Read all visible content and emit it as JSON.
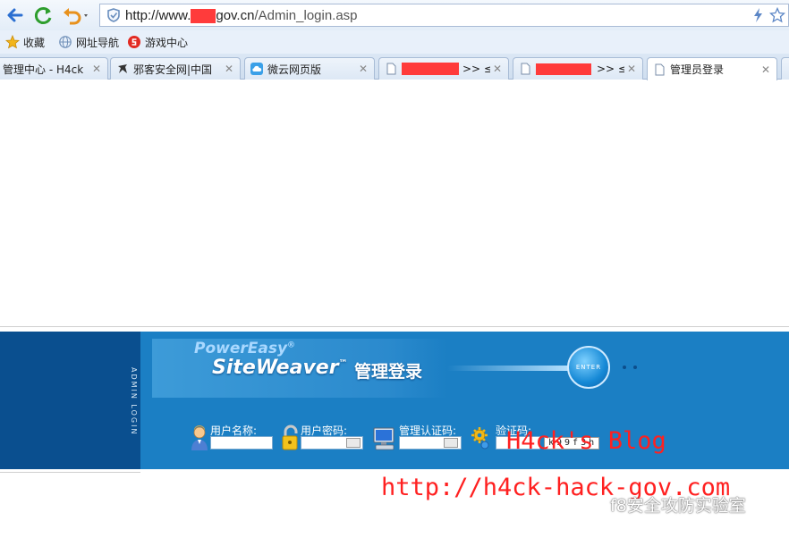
{
  "browser": {
    "url": {
      "prefix": "http://www.",
      "domain_tail": "gov.cn",
      "path": "/Admin_login.asp"
    },
    "bookmarks": [
      {
        "label": "收藏",
        "icon": "star-icon"
      },
      {
        "label": "网址导航",
        "icon": "globe-icon"
      },
      {
        "label": "游戏中心",
        "icon": "game-icon"
      }
    ],
    "tabs": [
      {
        "title": "管理中心 - H4ck",
        "icon": "none",
        "active": false
      },
      {
        "title": "邪客安全网|中国",
        "icon": "hacker-icon",
        "active": false
      },
      {
        "title": "微云网页版",
        "icon": "cloud-icon",
        "active": false
      },
      {
        "title": ">> ≤",
        "icon": "page-icon",
        "active": false
      },
      {
        "title": ">> ≤",
        "icon": "page-icon",
        "active": false
      },
      {
        "title": "管理员登录",
        "icon": "page-icon",
        "active": true
      }
    ],
    "close_glyph": "✕",
    "colors": {
      "redaction": "#ff3b3b"
    }
  },
  "login": {
    "vertical_text": "ADMIN LOGIN",
    "brand_top": "PowerEasy",
    "brand_top_mark": "®",
    "brand_main": "SiteWeaver",
    "brand_main_mark": "™",
    "brand_cn": "管理登录",
    "enter_label": "ENTER",
    "fields": {
      "username": {
        "label": "用户名称:",
        "value": ""
      },
      "password": {
        "label": "用户密码:",
        "value": ""
      },
      "auth_code": {
        "label": "管理认证码:",
        "value": ""
      },
      "captcha": {
        "label": "验证码:",
        "value": "",
        "image_text": "k99f3h"
      }
    },
    "colors": {
      "band": "#1b7fc4",
      "left_panel": "#0a4f8f"
    }
  },
  "overlay": {
    "handwritten_blog": "H4ck's   Blog",
    "handwritten_url": "http://h4ck-hack-gov.com",
    "watermark": "f8安全攻防实验室"
  }
}
